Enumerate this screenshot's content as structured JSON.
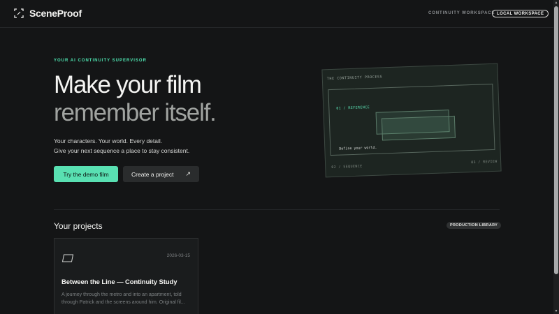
{
  "header": {
    "logo": "SceneProof",
    "nav_link": "CONTINUITY WORKSPACE",
    "workspace_pill": "LOCAL WORKSPACE"
  },
  "hero": {
    "eyebrow": "YOUR AI CONTINUITY SUPERVISOR",
    "title_line1": "Make your film",
    "title_line2": "remember itself.",
    "subtitle_line1": "Your characters. Your world. Every detail.",
    "subtitle_line2": "Give your next sequence a place to stay consistent.",
    "primary_cta": "Try the demo film",
    "secondary_cta": "Create a project",
    "secondary_cta_icon": "↗"
  },
  "process_card": {
    "title": "THE CONTINUITY PROCESS",
    "step1": "01 / REFERENCE",
    "define_text": "Define your world.",
    "step2": "02 / SEQUENCE",
    "step3": "03 / REVIEW"
  },
  "projects": {
    "title": "Your projects",
    "badge": "PRODUCTION LIBRARY",
    "items": [
      {
        "date": "2026-03-15",
        "title": "Between the Line — Continuity Study",
        "description": "A journey through the metro and into an apartment, told through Patrick and the screens around him. Original fil..."
      }
    ]
  },
  "colors": {
    "background": "#141516",
    "accent": "#59e0b2",
    "accent_text": "#4ee3b0"
  }
}
